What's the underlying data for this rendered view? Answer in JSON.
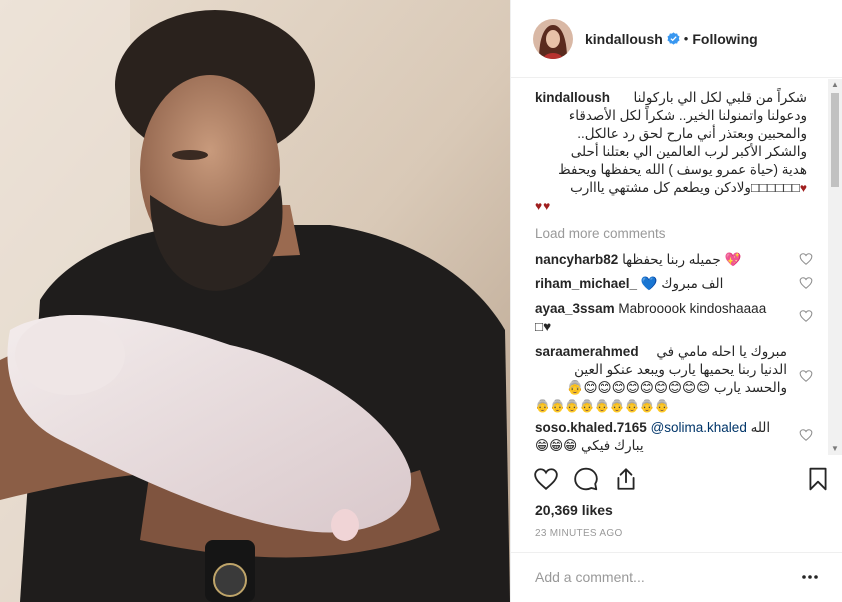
{
  "post": {
    "username": "kindalloush",
    "follow_status": "Following",
    "dot": "•",
    "caption_lines": [
      "شكراً من قلبي لكل الي باركولنا",
      "ودعولنا واتمنولنا الخير.. شكراً لكل الأصدقاء",
      "والمحبين وبعتذر أني مارح لحق رد عالكل..",
      "والشكر الأكبر لرب العالمين الي بعتلنا أحلى",
      "هدية (حياة عمرو يوسف ) الله يحفظها ويحفظ",
      "ولادكن ويطعم كل مشتهي يااارب"
    ],
    "caption_tail": "□□□□□□",
    "caption_hearts": "♥♥",
    "caption_heart_end": "♥",
    "load_more": "Load more comments",
    "likes": "20,369 likes",
    "time": "23 MINUTES AGO",
    "comment_placeholder": "Add a comment..."
  },
  "comments": [
    {
      "user": "nancyharb82",
      "text": "جميله ربنا يحفظها",
      "emoji": "💖"
    },
    {
      "user": "riham_michael_",
      "text": "الف مبروك",
      "emoji": "💙"
    },
    {
      "user": "ayaa_3ssam",
      "text": "Mabrooook kindoshaaaa",
      "extra": "□♥"
    },
    {
      "user": "saraamerahmed",
      "line1": "مبروك يا احله مامي في",
      "line2": "الدنيا ربنا يحميها يارب ويبعد عنكو العين",
      "line3a": "والحسد يارب",
      "line3b": "😊😊😊😊😊😊😊😊😊👵",
      "line4": "👵👵👵👵👵👵👵👵👵"
    },
    {
      "user": "soso.khaled.7165",
      "mention": "@solima.khaled",
      "text": "الله",
      "line2": "يبارك فيكي",
      "emoji": "😁😁😁"
    }
  ],
  "icons": [
    "verified-badge-icon",
    "heart-icon",
    "comment-icon",
    "share-icon",
    "bookmark-icon",
    "more-options-icon"
  ],
  "colors": {
    "verified": "#3897f0",
    "link": "#003569",
    "muted": "#999999",
    "heart": "#a01f1f"
  }
}
